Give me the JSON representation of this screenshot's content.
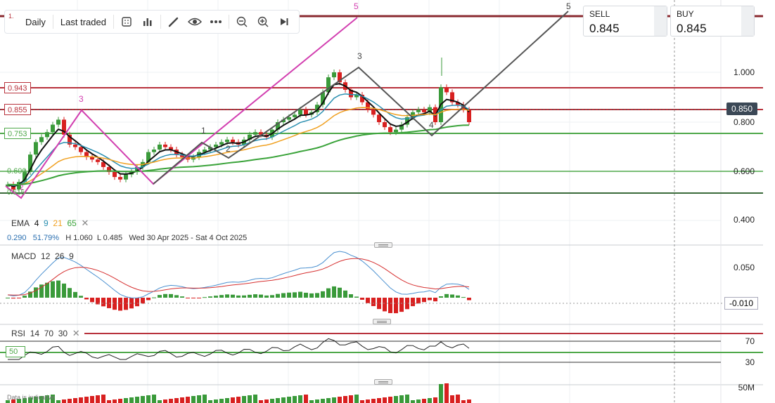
{
  "toolbar": {
    "first_label": "1.",
    "interval": "Daily",
    "price_type": "Last traded",
    "icons": [
      "calendar-grid-icon",
      "bar-chart-icon",
      "pen-icon",
      "eye-icon",
      "more-dots-icon",
      "zoom-out-icon",
      "zoom-in-icon",
      "play-forward-icon"
    ]
  },
  "sell": {
    "label": "SELL",
    "value": "0.845"
  },
  "buy": {
    "label": "BUY",
    "value": "0.845"
  },
  "levels": {
    "l943": "0.943",
    "l855": "0.855",
    "l753": "0.753",
    "l600": "0.600",
    "l515": "0.515"
  },
  "price_axis": [
    "1.000",
    "0.800",
    "0.600",
    "0.400"
  ],
  "current_price": "0.850",
  "wave_labels": {
    "w1": "1",
    "w2": "2",
    "w3": "3",
    "w4": "4",
    "w5": "5",
    "m3": "3",
    "m5": "5",
    "m2": "2"
  },
  "ema_legend": {
    "name": "EMA",
    "p1": "4",
    "p2": "9",
    "p3": "21",
    "p4": "65"
  },
  "stats": {
    "value": "0.290",
    "change": "51.79%",
    "high": "H 1.060",
    "low": "L 0.485",
    "range": "Wed 30 Apr 2025 - Sat 4 Oct 2025"
  },
  "macd_legend": {
    "name": "MACD",
    "p1": "12",
    "p2": "26",
    "p3": "9"
  },
  "macd_axis": {
    "top": "0.050",
    "current": "-0.010"
  },
  "rsi_legend": {
    "name": "RSI",
    "p1": "14",
    "p2": "70",
    "p3": "30"
  },
  "rsi_axis": {
    "top": "70",
    "bottom": "30"
  },
  "rsi_value": "50",
  "volume_axis": "50M",
  "disclaimer": "Data is indicative",
  "colors": {
    "bull": "#3a9a3a",
    "bear": "#d82020",
    "resistance": "#b8323c",
    "support": "#4fa84a",
    "ema4": "#111111",
    "ema9": "#2a8fb0",
    "ema21": "#f0a020",
    "ema65": "#3aa33a",
    "wave_pink": "#d23fb0",
    "wave_grey": "#555555",
    "macd_line": "#4a90d0",
    "signal_line": "#d63030"
  }
}
